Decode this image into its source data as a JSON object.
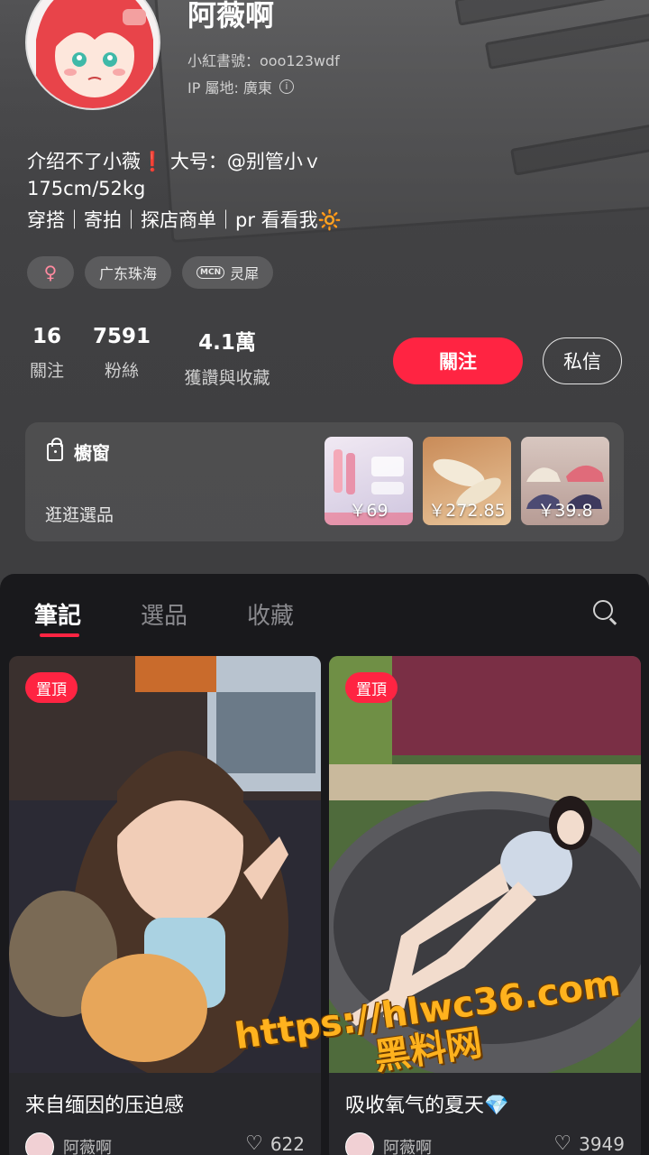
{
  "profile": {
    "name": "阿薇啊",
    "red_id": "小紅書號：ooo123wdf",
    "ip_location": "IP 屬地: 廣東",
    "bio_line1_a": "介绍不了小薇",
    "bio_line1_exclaim": "❗",
    "bio_line1_b": " 大号：@别管小ｖ",
    "bio_line2": "175cm/52kg",
    "bio_line3": "穿搭｜寄拍｜探店商单｜pr 看看我",
    "bio_line3_emoji": "🔆",
    "tags": {
      "gender_symbol": "♀",
      "location": "广东珠海",
      "mcn_badge": "MCN",
      "mcn_name": "灵犀"
    }
  },
  "stats": [
    {
      "num": "16",
      "label": "關注"
    },
    {
      "num": "7591",
      "label": "粉絲"
    },
    {
      "num": "4.1萬",
      "label": "獲讚與收藏"
    }
  ],
  "actions": {
    "follow": "關注",
    "message": "私信"
  },
  "shop": {
    "title": "櫥窗",
    "subtitle": "逛逛選品",
    "products": [
      {
        "price": "￥69"
      },
      {
        "price": "￥272.85"
      },
      {
        "price": "￥39.8"
      }
    ]
  },
  "tabs": {
    "notes": "筆記",
    "products": "選品",
    "favorites": "收藏"
  },
  "notes": [
    {
      "pin": "置頂",
      "title": "来自缅因的压迫感",
      "author": "阿薇啊",
      "likes": "622"
    },
    {
      "pin": "置頂",
      "title": "吸收氧气的夏天",
      "title_emoji": "💎",
      "author": "阿薇啊",
      "likes": "3949"
    }
  ],
  "watermark": {
    "url": "https://hlwc36.com",
    "name": "黑料网"
  },
  "colors": {
    "accent": "#ff2442",
    "panel": "#19191c"
  }
}
